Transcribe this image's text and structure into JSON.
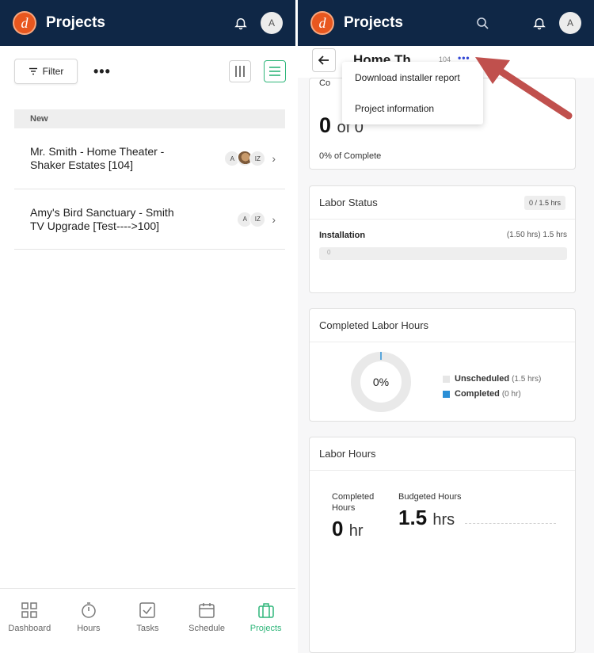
{
  "left": {
    "app_title": "Projects",
    "avatar": "A",
    "toolbar": {
      "filter_label": "Filter",
      "more_label": "•••"
    },
    "section_label": "New",
    "projects": [
      {
        "name": "Mr. Smith - Home Theater - Shaker Estates [104]",
        "avatars": [
          "A",
          "",
          "IZ"
        ]
      },
      {
        "name": "Amy's Bird Sanctuary - Smith TV Upgrade [Test---->100]",
        "avatars": [
          "A",
          "IZ"
        ]
      }
    ],
    "nav": [
      {
        "label": "Dashboard",
        "icon": "grid-icon"
      },
      {
        "label": "Hours",
        "icon": "stopwatch-icon"
      },
      {
        "label": "Tasks",
        "icon": "checkbox-icon"
      },
      {
        "label": "Schedule",
        "icon": "calendar-icon"
      },
      {
        "label": "Projects",
        "icon": "briefcase-icon",
        "active": true
      }
    ]
  },
  "right": {
    "app_title": "Projects",
    "avatar": "A",
    "subheader": {
      "title": "Home Th",
      "number": "104",
      "dots": "•••"
    },
    "dropdown": [
      "Download installer report",
      "Project information"
    ],
    "completion_card": {
      "head": "Co",
      "count": "0",
      "of": "of 0",
      "percent_text": "0% of Complete"
    },
    "labor_status": {
      "title": "Labor Status",
      "pill": "0 / 1.5 hrs",
      "item_label": "Installation",
      "item_hours": "(1.50 hrs) 1.5 hrs",
      "progress_value": "0",
      "progress_fraction": 0
    },
    "completed_labor": {
      "title": "Completed Labor Hours",
      "center_text": "0%",
      "completed_fraction": 0,
      "legend": [
        {
          "name": "Unscheduled",
          "value": "(1.5 hrs)",
          "color": "#e6e6e6"
        },
        {
          "name": "Completed",
          "value": "(0 hr)",
          "color": "#2b8fd6"
        }
      ]
    },
    "labor_hours": {
      "title": "Labor Hours",
      "completed_label": "Completed Hours",
      "completed_value": "0",
      "completed_unit": "hr",
      "budgeted_label": "Budgeted Hours",
      "budgeted_value": "1.5",
      "budgeted_unit": "hrs"
    }
  },
  "colors": {
    "appbar": "#0f2746",
    "accent": "#2fb67a",
    "logo": "#e8571f",
    "arrow": "#c0504d"
  }
}
